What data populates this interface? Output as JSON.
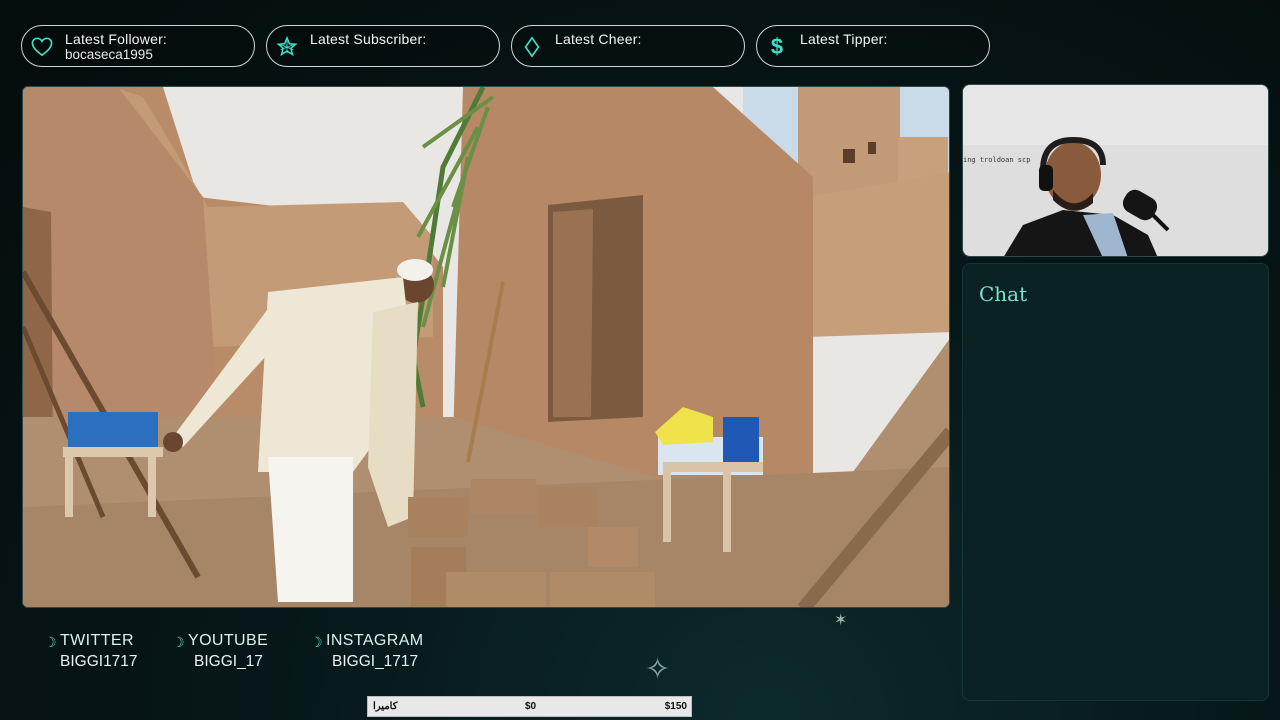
{
  "alerts": [
    {
      "icon": "heart-icon",
      "label": "Latest Follower:",
      "value": "bocaseca1995"
    },
    {
      "icon": "star-icon",
      "label": "Latest Subscriber:",
      "value": ""
    },
    {
      "icon": "diamond-icon",
      "label": "Latest Cheer:",
      "value": ""
    },
    {
      "icon": "dollar-icon",
      "label": "Latest Tipper:",
      "value": ""
    }
  ],
  "chat": {
    "title": "Chat"
  },
  "socials": [
    {
      "network": "TWITTER",
      "handle": "BIGGI1717"
    },
    {
      "network": "YOUTUBE",
      "handle": "BIGGI_17"
    },
    {
      "network": "INSTAGRAM",
      "handle": "BIGGI_1717"
    }
  ],
  "goal": {
    "label": "كاميرا",
    "current": "$0",
    "target": "$150",
    "progress": 0
  },
  "webcam": {
    "overlay_text": "ing troldoan scp"
  },
  "colors": {
    "accent": "#3fe0c4",
    "chat_title": "#7fe0d3",
    "panel": "#0b2223"
  }
}
